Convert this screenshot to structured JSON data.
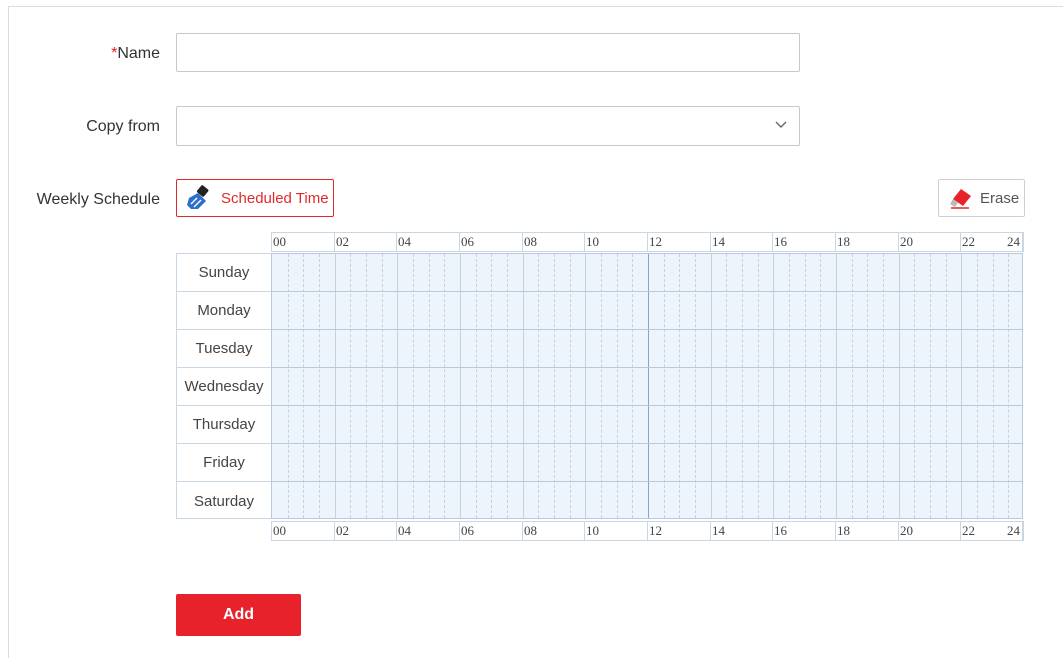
{
  "form": {
    "name_required_mark": "*",
    "name_label": "Name",
    "name_value": "",
    "copy_from_label": "Copy from",
    "copy_from_value": "",
    "weekly_schedule_label": "Weekly Schedule"
  },
  "toolbar": {
    "scheduled_time_label": "Scheduled Time",
    "erase_label": "Erase"
  },
  "schedule": {
    "hour_labels": [
      "00",
      "02",
      "04",
      "06",
      "08",
      "10",
      "12",
      "14",
      "16",
      "18",
      "20",
      "22",
      "24"
    ],
    "days": [
      "Sunday",
      "Monday",
      "Tuesday",
      "Wednesday",
      "Thursday",
      "Friday",
      "Saturday"
    ]
  },
  "actions": {
    "add_label": "Add"
  },
  "colors": {
    "accent_red": "#e8222a",
    "grid_fill": "#eef4fc",
    "grid_line": "#b9c9dc"
  },
  "icons": {
    "scheduled_time": "brush-icon",
    "erase": "eraser-icon",
    "dropdown": "chevron-down-icon"
  }
}
